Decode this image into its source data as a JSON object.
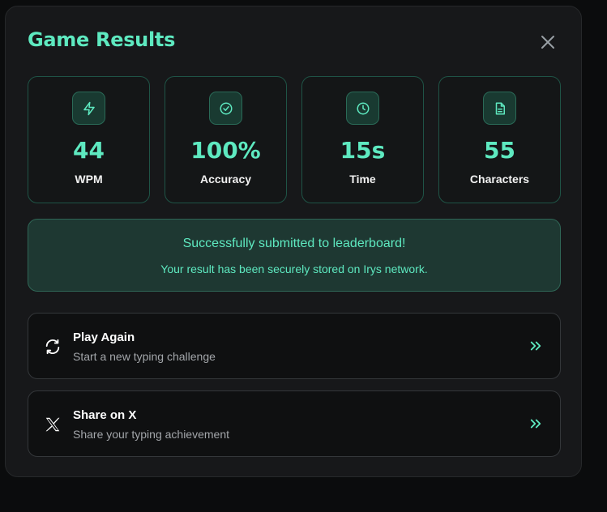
{
  "modal": {
    "title": "Game Results",
    "close_icon": "close-icon"
  },
  "stats": [
    {
      "icon": "lightning-icon",
      "value": "44",
      "label": "WPM"
    },
    {
      "icon": "check-circle-icon",
      "value": "100%",
      "label": "Accuracy"
    },
    {
      "icon": "clock-icon",
      "value": "15s",
      "label": "Time"
    },
    {
      "icon": "document-icon",
      "value": "55",
      "label": "Characters"
    }
  ],
  "submission": {
    "headline": "Successfully submitted to leaderboard!",
    "detail": "Your result has been securely stored on Irys network."
  },
  "actions": [
    {
      "icon": "refresh-icon",
      "title": "Play Again",
      "subtitle": "Start a new typing challenge",
      "arrow_icon": "double-chevron-right-icon"
    },
    {
      "icon": "x-logo-icon",
      "title": "Share on X",
      "subtitle": "Share your typing achievement",
      "arrow_icon": "double-chevron-right-icon"
    }
  ],
  "colors": {
    "accent": "#5ee9c0",
    "panel": "#17181a",
    "success_bg": "#1e3832"
  }
}
